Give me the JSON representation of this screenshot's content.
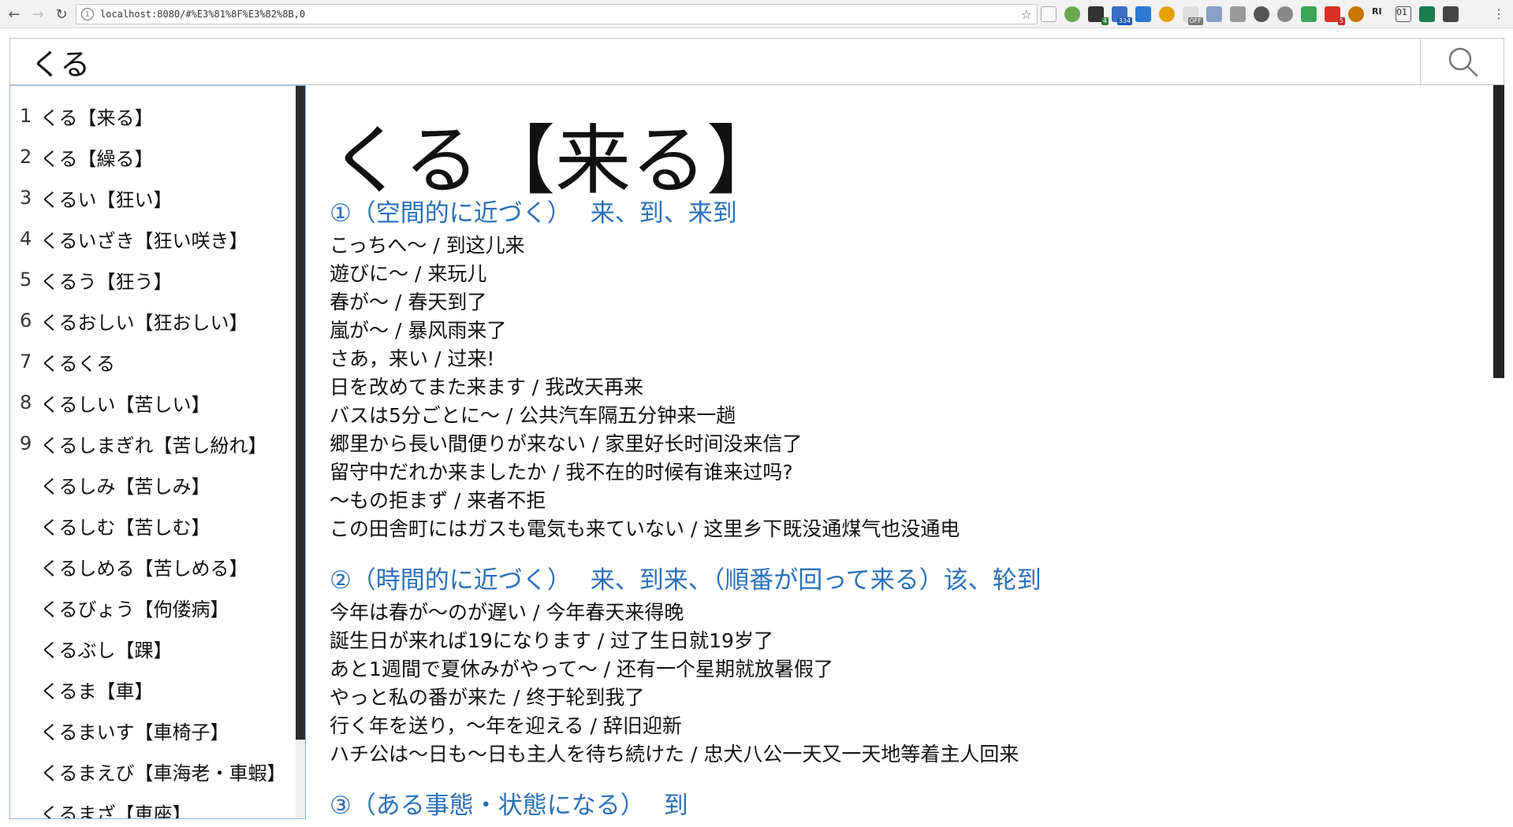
{
  "browser": {
    "url": "localhost:8080/#%E3%81%8F%E3%82%8B,0",
    "extension_badges": [
      "4",
      "334",
      "OFF",
      "5",
      "5"
    ],
    "extension_labels": [
      "RI",
      "01"
    ],
    "colors": {
      "accent": "#2a70b8",
      "list_border": "#8fb4e6"
    }
  },
  "search": {
    "query": "くる",
    "icon": "search-icon"
  },
  "results": [
    {
      "num": "1",
      "text": "くる【来る】"
    },
    {
      "num": "2",
      "text": "くる【繰る】"
    },
    {
      "num": "3",
      "text": "くるい【狂い】"
    },
    {
      "num": "4",
      "text": "くるいざき【狂い咲き】"
    },
    {
      "num": "5",
      "text": "くるう【狂う】"
    },
    {
      "num": "6",
      "text": "くるおしい【狂おしい】"
    },
    {
      "num": "7",
      "text": "くるくる"
    },
    {
      "num": "8",
      "text": "くるしい【苦しい】"
    },
    {
      "num": "9",
      "text": "くるしまぎれ【苦し紛れ】"
    },
    {
      "num": "",
      "text": "くるしみ【苦しみ】"
    },
    {
      "num": "",
      "text": "くるしむ【苦しむ】"
    },
    {
      "num": "",
      "text": "くるしめる【苦しめる】"
    },
    {
      "num": "",
      "text": "くるびょう【佝偻病】"
    },
    {
      "num": "",
      "text": "くるぶし【踝】"
    },
    {
      "num": "",
      "text": "くるま【車】"
    },
    {
      "num": "",
      "text": "くるまいす【車椅子】"
    },
    {
      "num": "",
      "text": "くるまえび【車海老・車蝦】"
    },
    {
      "num": "",
      "text": "くるまざ【車座】"
    }
  ],
  "entry": {
    "title": "くる【来る】",
    "senses": [
      {
        "head": "①（空間的に近づく）",
        "zh": "来、到、来到",
        "examples": [
          "こっちへ～ / 到这儿来",
          "遊びに～ / 来玩儿",
          "春が～ / 春天到了",
          "嵐が～ / 暴风雨来了",
          "さあ，来い / 过来!",
          "日を改めてまた来ます / 我改天再来",
          "バスは5分ごとに～ / 公共汽车隔五分钟来一趟",
          "郷里から長い間便りが来ない / 家里好长时间没来信了",
          "留守中だれか来ましたか / 我不在的时候有谁来过吗?",
          "～もの拒まず / 来者不拒",
          "この田舎町にはガスも電気も来ていない / 这里乡下既没通煤气也没通电"
        ]
      },
      {
        "head": "②（時間的に近づく）",
        "zh": "来、到来、（順番が回って来る）该、轮到",
        "examples": [
          "今年は春が～のが遅い / 今年春天来得晚",
          "誕生日が来れば19になります / 过了生日就19岁了",
          "あと1週間で夏休みがやって～ / 还有一个星期就放暑假了",
          "やっと私の番が来た / 终于轮到我了",
          "行く年を送り，～年を迎える / 辞旧迎新",
          "ハチ公は～日も～日も主人を待ち続けた / 忠犬八公一天又一天地等着主人回来"
        ]
      },
      {
        "head": "③（ある事態・状態になる）",
        "zh": "到",
        "examples": []
      }
    ]
  }
}
